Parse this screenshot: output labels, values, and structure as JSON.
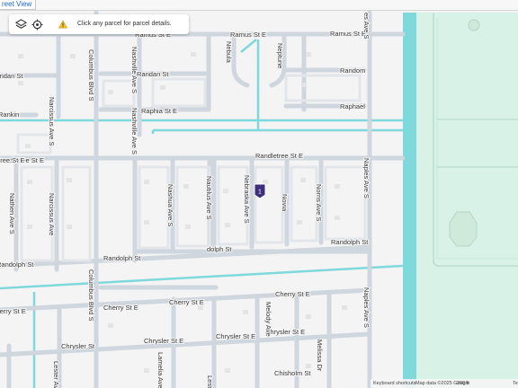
{
  "topbar": {
    "street_view": "reet View"
  },
  "toolbar": {
    "layers_icon": "layers-icon",
    "locate_icon": "target-icon",
    "hint_icon": "warning-icon",
    "hint": "Click any parcel for parcel details."
  },
  "map": {
    "marker_label": "1",
    "colors": {
      "road": "#cfd6de",
      "canal": "#7fd8dc",
      "park": "#d9f2e7",
      "marker": "#3f2f7a"
    },
    "street_labels": {
      "ramus_1": "Ramus St E",
      "ramus_2": "Ramus St E",
      "ramus_3": "Ramus St E",
      "randan_1": "Randan St",
      "randan_2": "Randan St",
      "random": "Random",
      "raphia": "Raphia St E",
      "raphael": "Raphael",
      "rankin": "Rankin",
      "randletree_1": "Randletree St E",
      "randletree_2": "Randletree St E",
      "randolph_1": "Randolph St",
      "randolph_2": "Randolph St",
      "randolph_3": "Randolph St",
      "cherry_1": "Cherry St E",
      "cherry_2": "Cherry St E",
      "cherry_3": "Cherry St E",
      "chrysler_1": "Chrysler St",
      "chrysler_2": "Chrysler St E",
      "chrysler_3": "Chrysler St E",
      "chisholm": "Chisholm St",
      "columbus_1": "Columbus Blvd S",
      "columbus_2": "Columbus Blvd S",
      "nashville_1": "Nashville Ave S",
      "nashville_2": "Nashville Ave S",
      "narcissus_1": "Narcissus Ave S",
      "narcissus_2": "Narcissus Ave",
      "nathen": "Nathen Ave S",
      "nashua": "Nashua Ave S",
      "nautilus": "Nautilus Ave S",
      "nebraska": "Nebraska Ave S",
      "novia": "Novia",
      "norris": "Norris Ave S",
      "naples_1": "Naples Ave S",
      "naples_2": "Naples Ave S",
      "naples_top": "es Ave S",
      "nebula": "Nebula",
      "neptune": "Neptune",
      "melody": "Melody Ave",
      "melissa": "Melissa Dr",
      "lamelia": "Lamelia Ave",
      "lester": "Lester Ave",
      "dolph": "dolph St",
      "randlet_cut": "ndletree St E"
    }
  },
  "footer": {
    "shortcuts": "Keyboard shortcuts",
    "attribution": "Map data ©2025 Google",
    "scale": "200 ft",
    "terms": "Te"
  }
}
